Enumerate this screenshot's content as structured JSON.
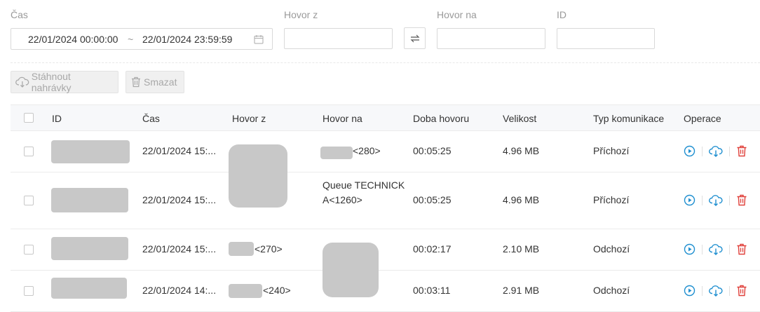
{
  "filters": {
    "time_label": "Čas",
    "time_from": "22/01/2024 00:00:00",
    "time_sep": "~",
    "time_to": "22/01/2024 23:59:59",
    "call_from_label": "Hovor z",
    "call_from_value": "",
    "call_to_label": "Hovor na",
    "call_to_value": "",
    "id_label": "ID",
    "id_value": ""
  },
  "toolbar": {
    "download_label": "Stáhnout nahrávky",
    "delete_label": "Smazat"
  },
  "table": {
    "columns": [
      "ID",
      "Čas",
      "Hovor z",
      "Hovor na",
      "Doba hovoru",
      "Velikost",
      "Typ komunikace",
      "Operace"
    ],
    "rows": [
      {
        "id": "",
        "time": "22/01/2024 15:...",
        "from": "",
        "to": "<280>",
        "duration": "00:05:25",
        "size": "4.96 MB",
        "type": "Příchozí"
      },
      {
        "id": "",
        "time": "22/01/2024 15:...",
        "from": "",
        "to": "Queue TECHNICKA<1260>",
        "duration": "00:05:25",
        "size": "4.96 MB",
        "type": "Příchozí"
      },
      {
        "id": "",
        "time": "22/01/2024 15:...",
        "from": "<270>",
        "to": "",
        "duration": "00:02:17",
        "size": "2.10 MB",
        "type": "Odchozí"
      },
      {
        "id": "",
        "time": "22/01/2024 14:...",
        "from": "<240>",
        "to": "",
        "duration": "00:03:11",
        "size": "2.91 MB",
        "type": "Odchozí"
      }
    ]
  },
  "colors": {
    "accent": "#1f8fd0",
    "danger": "#e0403a",
    "redaction": "#c8c8c8"
  }
}
